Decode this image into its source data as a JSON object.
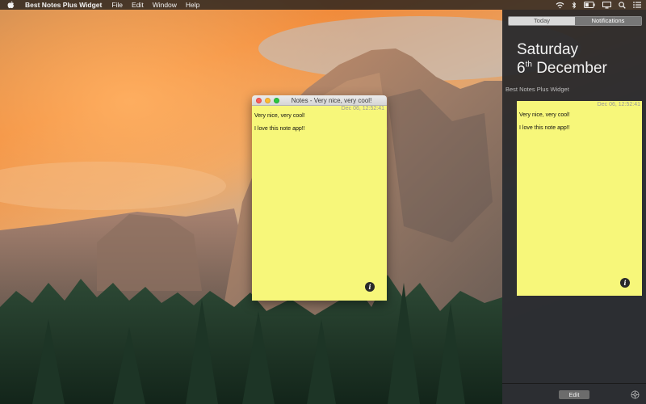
{
  "menubar": {
    "apple_icon": "apple-icon",
    "app_name": "Best Notes Plus Widget",
    "items": [
      "File",
      "Edit",
      "Window",
      "Help"
    ],
    "status_icons": [
      "wifi-icon",
      "bluetooth-icon",
      "battery-icon",
      "display-icon",
      "search-icon",
      "notification-center-icon"
    ]
  },
  "note_window": {
    "title": "Notes - Very nice, very cool!",
    "date": "Dec 06, 12:52:41",
    "lines": [
      "Very nice, very cool!",
      "I love this note app!!"
    ],
    "info_label": "i"
  },
  "notification_center": {
    "tabs": [
      {
        "label": "Today"
      },
      {
        "label": "Notifications"
      }
    ],
    "selected_tab": "Notifications",
    "day": "Saturday",
    "date_number": "6",
    "date_suffix": "th",
    "date_month": "December",
    "widget_title": "Best Notes Plus Widget",
    "widget_note": {
      "date": "Dec 06, 12:52:41",
      "lines": [
        "Very nice, very cool!",
        "I love this note app!!"
      ],
      "info_label": "i"
    },
    "edit_label": "Edit",
    "gear_icon": "gear-icon"
  },
  "colors": {
    "note_yellow": "#f7f77a",
    "close": "#fc5f57",
    "minimize": "#fdbc2e",
    "maximize": "#28c840"
  }
}
